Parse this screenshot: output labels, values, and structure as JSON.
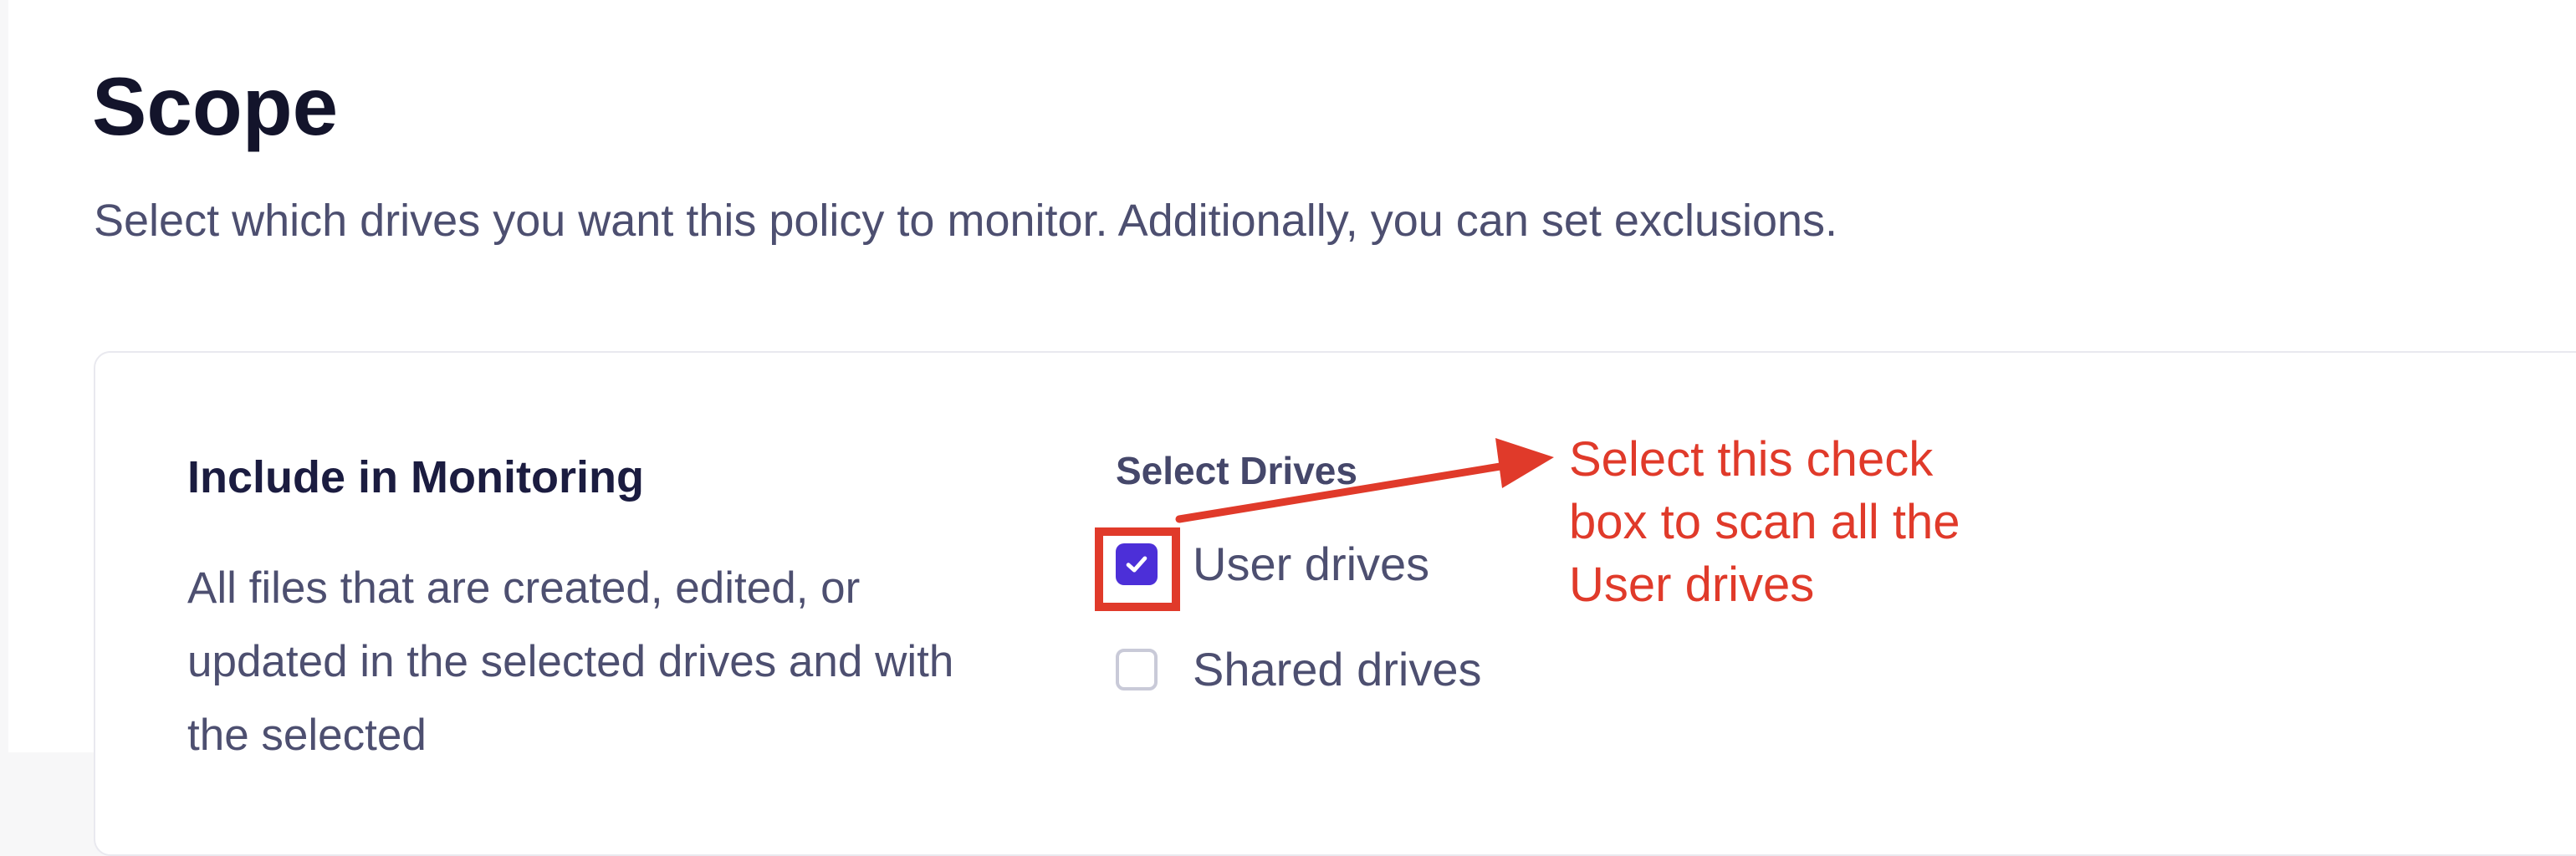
{
  "page": {
    "title": "Scope",
    "description": "Select which drives you want this policy to monitor. Additionally, you can set exclusions."
  },
  "monitoring": {
    "title": "Include in Monitoring",
    "description": "All files that are created, edited, or updated in the selected drives and with the selected",
    "select_drives_label": "Select Drives",
    "drives": [
      {
        "label": "User drives",
        "checked": true
      },
      {
        "label": "Shared drives",
        "checked": false
      }
    ]
  },
  "annotation": {
    "lines": [
      "Select this check",
      "box to scan all the",
      "User drives"
    ],
    "color": "#e03a2a"
  },
  "colors": {
    "checkbox_checked": "#4c2fd8",
    "title_text": "#13142b",
    "body_text": "#4d4f70"
  },
  "icons": {
    "checkmark": "check-icon",
    "arrow": "arrow-right-icon"
  }
}
